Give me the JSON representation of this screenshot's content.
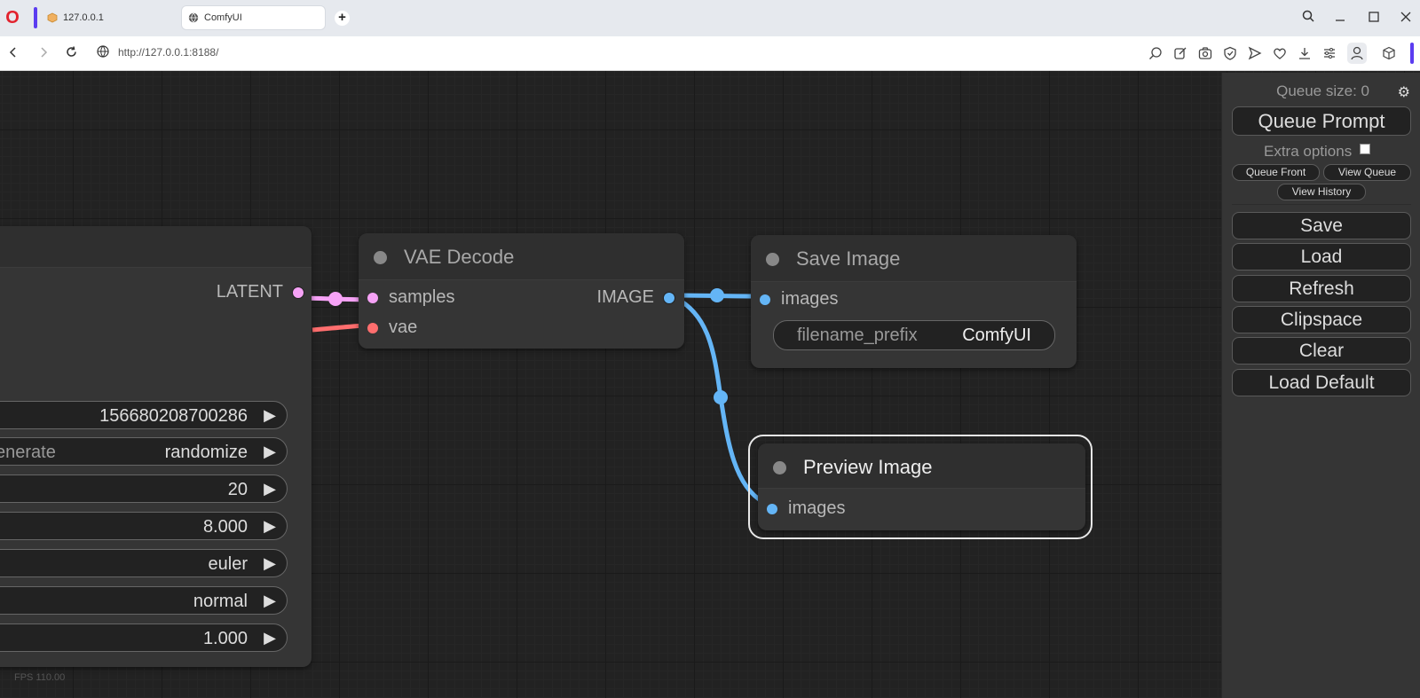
{
  "browser": {
    "tabs": [
      {
        "label": "127.0.0.1"
      },
      {
        "label": "ComfyUI"
      }
    ],
    "url": "http://127.0.0.1:8188/",
    "new_tab_symbol": "+",
    "logo_letter": "O"
  },
  "graph": {
    "ksampler": {
      "output_label": "LATENT",
      "widgets": [
        {
          "label": "",
          "value": "156680208700286"
        },
        {
          "label": "enerate",
          "value": "randomize"
        },
        {
          "label": "",
          "value": "20"
        },
        {
          "label": "",
          "value": "8.000"
        },
        {
          "label": "",
          "value": "euler"
        },
        {
          "label": "",
          "value": "normal"
        },
        {
          "label": "",
          "value": "1.000"
        }
      ],
      "faded_text": "FPS 110.00"
    },
    "vae_decode": {
      "title": "VAE Decode",
      "inputs": [
        "samples",
        "vae"
      ],
      "output": "IMAGE"
    },
    "save_image": {
      "title": "Save Image",
      "input": "images",
      "widget": {
        "label": "filename_prefix",
        "value": "ComfyUI"
      }
    },
    "preview_image": {
      "title": "Preview Image",
      "input": "images"
    },
    "colors": {
      "latent": "#f6a2f6",
      "image": "#64b5f6",
      "vae": "#ff6e6e"
    }
  },
  "menu": {
    "queue_size_label": "Queue size: 0",
    "queue_prompt": "Queue Prompt",
    "extra_options": "Extra options",
    "extra_options_checked": false,
    "queue_front": "Queue Front",
    "view_queue": "View Queue",
    "view_history": "View History",
    "buttons": [
      "Save",
      "Load",
      "Refresh",
      "Clipspace",
      "Clear",
      "Load Default"
    ]
  }
}
